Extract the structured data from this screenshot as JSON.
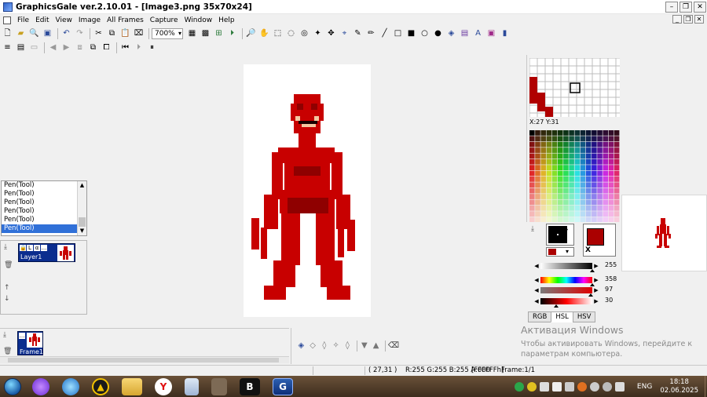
{
  "window": {
    "title": "GraphicsGale ver.2.10.01 - [Image3.png 35x70x24]"
  },
  "menu": [
    "File",
    "Edit",
    "View",
    "Image",
    "All Frames",
    "Capture",
    "Window",
    "Help"
  ],
  "toolbar": {
    "zoom": "700%"
  },
  "history": {
    "items": [
      "Pen(Tool)",
      "Pen(Tool)",
      "Pen(Tool)",
      "Pen(Tool)",
      "Pen(Tool)",
      "Pen(Tool)"
    ],
    "selected_index": 5
  },
  "layers": {
    "items": [
      {
        "name": "Layer1",
        "flags": [
          "🔒",
          "L",
          "α",
          "..."
        ]
      }
    ]
  },
  "frames": {
    "items": [
      {
        "name": "Frame1"
      }
    ]
  },
  "zoom_panel": {
    "coordinate": "X:27 Y:31"
  },
  "colors": {
    "foreground": "#000000",
    "background": "#aa0000",
    "accent": "#aa0000",
    "sliders": [
      {
        "name": "hue",
        "value": "255",
        "position": 1.0
      },
      {
        "name": "hue-spectrum",
        "value": "358",
        "position": 0.994
      },
      {
        "name": "saturation",
        "value": "97",
        "position": 0.97
      },
      {
        "name": "lightness",
        "value": "30",
        "position": 0.3
      }
    ]
  },
  "color_tabs": [
    "RGB",
    "HSL",
    "HSV"
  ],
  "color_tabs_active": 1,
  "watermark": {
    "line1": "Активация Windows",
    "line2": "Чтобы активировать Windows, перейдите к",
    "line3": "параметрам компьютера."
  },
  "status": {
    "coords": "( 27,31 )",
    "color": "R:255 G:255 B:255 A:000",
    "hex": "[FFFFFFh]",
    "frame": "Frame:1/1"
  },
  "taskbar": {
    "lang": "ENG",
    "time": "18:18",
    "date": "02.06.2025"
  }
}
